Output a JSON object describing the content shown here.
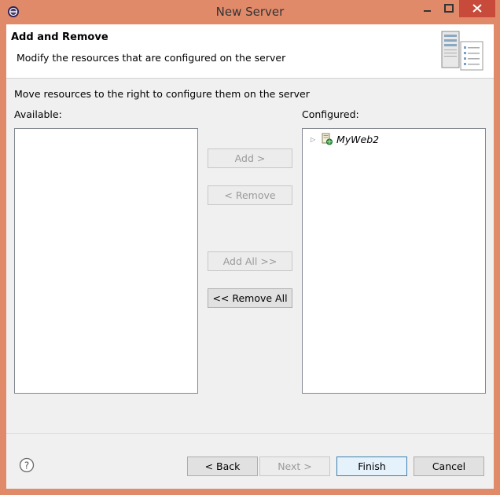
{
  "window": {
    "title": "New Server"
  },
  "banner": {
    "title": "Add and Remove",
    "description": "Modify the resources that are configured on the server"
  },
  "instruction": "Move resources to the right to configure them on the server",
  "available": {
    "label": "Available:",
    "items": []
  },
  "configured": {
    "label": "Configured:",
    "items": [
      {
        "label": "MyWeb2"
      }
    ]
  },
  "buttons": {
    "add": "Add >",
    "remove": "< Remove",
    "add_all": "Add All >>",
    "remove_all": "<< Remove All"
  },
  "footer": {
    "back": "< Back",
    "next": "Next >",
    "finish": "Finish",
    "cancel": "Cancel"
  },
  "icons": {
    "app": "eclipse-icon",
    "banner": "server-icon",
    "project": "web-project-icon",
    "help": "help-icon"
  }
}
